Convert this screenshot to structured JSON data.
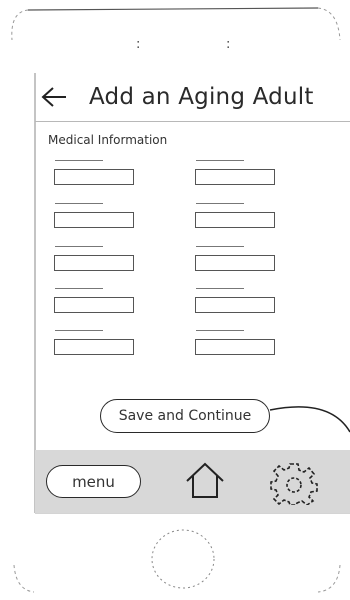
{
  "screen": {
    "title": "Add an Aging Adult",
    "section_label": "Medical Information",
    "fields": {
      "left": [
        "",
        "",
        "",
        "",
        ""
      ],
      "right": [
        "",
        "",
        "",
        "",
        ""
      ]
    },
    "save_label": "Save and Continue"
  },
  "bottom_bar": {
    "menu_label": "menu",
    "home_icon": "home-icon",
    "settings_icon": "gear-icon"
  },
  "status_bar": {
    "dots": [
      ":",
      ":"
    ]
  }
}
